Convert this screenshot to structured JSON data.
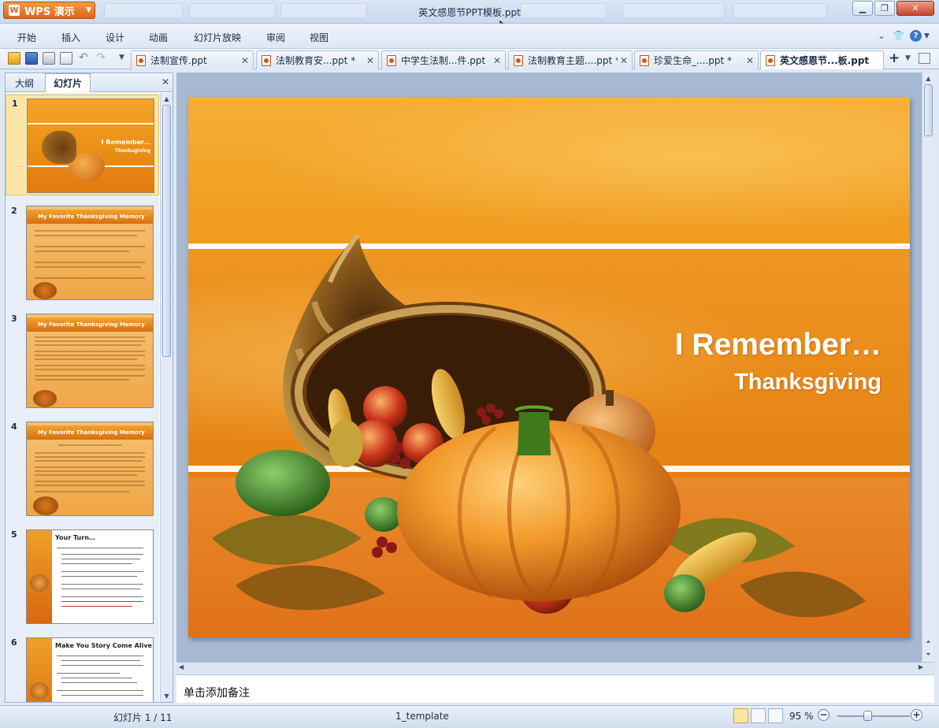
{
  "app": {
    "brand_label": "WPS 演示",
    "window_title": "英文感恩节PPT模板.ppt"
  },
  "menu": {
    "items": [
      "开始",
      "插入",
      "设计",
      "动画",
      "幻灯片放映",
      "审阅",
      "视图"
    ]
  },
  "doc_tabs": [
    {
      "label": "法制宣传.ppt",
      "active": false
    },
    {
      "label": "法制教育安...ppt *",
      "active": false
    },
    {
      "label": "中学生法制...件.ppt",
      "active": false
    },
    {
      "label": "法制教育主题....ppt *",
      "active": false
    },
    {
      "label": "珍爱生命_....ppt *",
      "active": false
    },
    {
      "label": "英文感恩节...板.ppt",
      "active": true
    }
  ],
  "left_pane": {
    "tab_outline": "大纲",
    "tab_slides": "幻灯片",
    "thumbnails": [
      {
        "number": "1",
        "title": "I Remember…",
        "subtitle": "Thanksgiving"
      },
      {
        "number": "2",
        "title": "My Favorite Thanksgiving Memory"
      },
      {
        "number": "3",
        "title": "My Favorite Thanksgiving Memory"
      },
      {
        "number": "4",
        "title": "My Favorite Thanksgiving Memory"
      },
      {
        "number": "5",
        "title": "Your Turn…"
      },
      {
        "number": "6",
        "title": "Make You Story Come Alive"
      }
    ]
  },
  "slide": {
    "title": "I Remember…",
    "subtitle": "Thanksgiving"
  },
  "notes": {
    "placeholder": "单击添加备注"
  },
  "status": {
    "slide_counter": "幻灯片 1 / 11",
    "template": "1_template",
    "zoom": "95 %"
  },
  "colors": {
    "accent_orange": "#e0641c",
    "selected_thumb": "#fbe6a8"
  }
}
